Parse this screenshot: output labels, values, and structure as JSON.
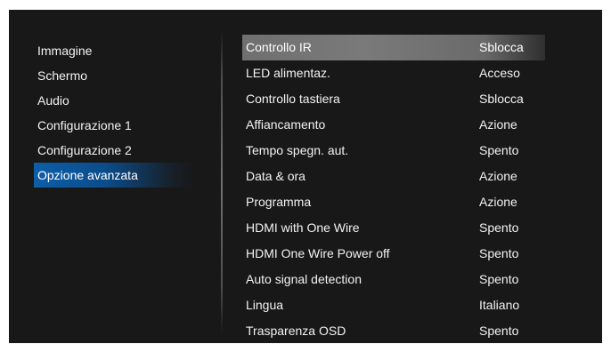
{
  "left_menu": {
    "items": [
      {
        "label": "Immagine"
      },
      {
        "label": "Schermo"
      },
      {
        "label": "Audio"
      },
      {
        "label": "Configurazione 1"
      },
      {
        "label": "Configurazione 2"
      },
      {
        "label": "Opzione avanzata"
      }
    ],
    "active_index": 5
  },
  "settings": {
    "rows": [
      {
        "label": "Controllo IR",
        "value": "Sblocca"
      },
      {
        "label": "LED alimentaz.",
        "value": "Acceso"
      },
      {
        "label": "Controllo tastiera",
        "value": "Sblocca"
      },
      {
        "label": "Affiancamento",
        "value": "Azione"
      },
      {
        "label": "Tempo spegn. aut.",
        "value": "Spento"
      },
      {
        "label": "Data & ora",
        "value": "Azione"
      },
      {
        "label": "Programma",
        "value": "Azione"
      },
      {
        "label": "HDMI with One Wire",
        "value": "Spento"
      },
      {
        "label": "HDMI One Wire Power off",
        "value": "Spento"
      },
      {
        "label": "Auto signal detection",
        "value": "Spento"
      },
      {
        "label": "Lingua",
        "value": "Italiano"
      },
      {
        "label": "Trasparenza OSD",
        "value": "Spento"
      }
    ],
    "selected_index": 0
  },
  "colors": {
    "background": "#181818",
    "active_menu": "#0d5ea8",
    "selected_row": "#757575",
    "text": "#f2f2f2"
  }
}
